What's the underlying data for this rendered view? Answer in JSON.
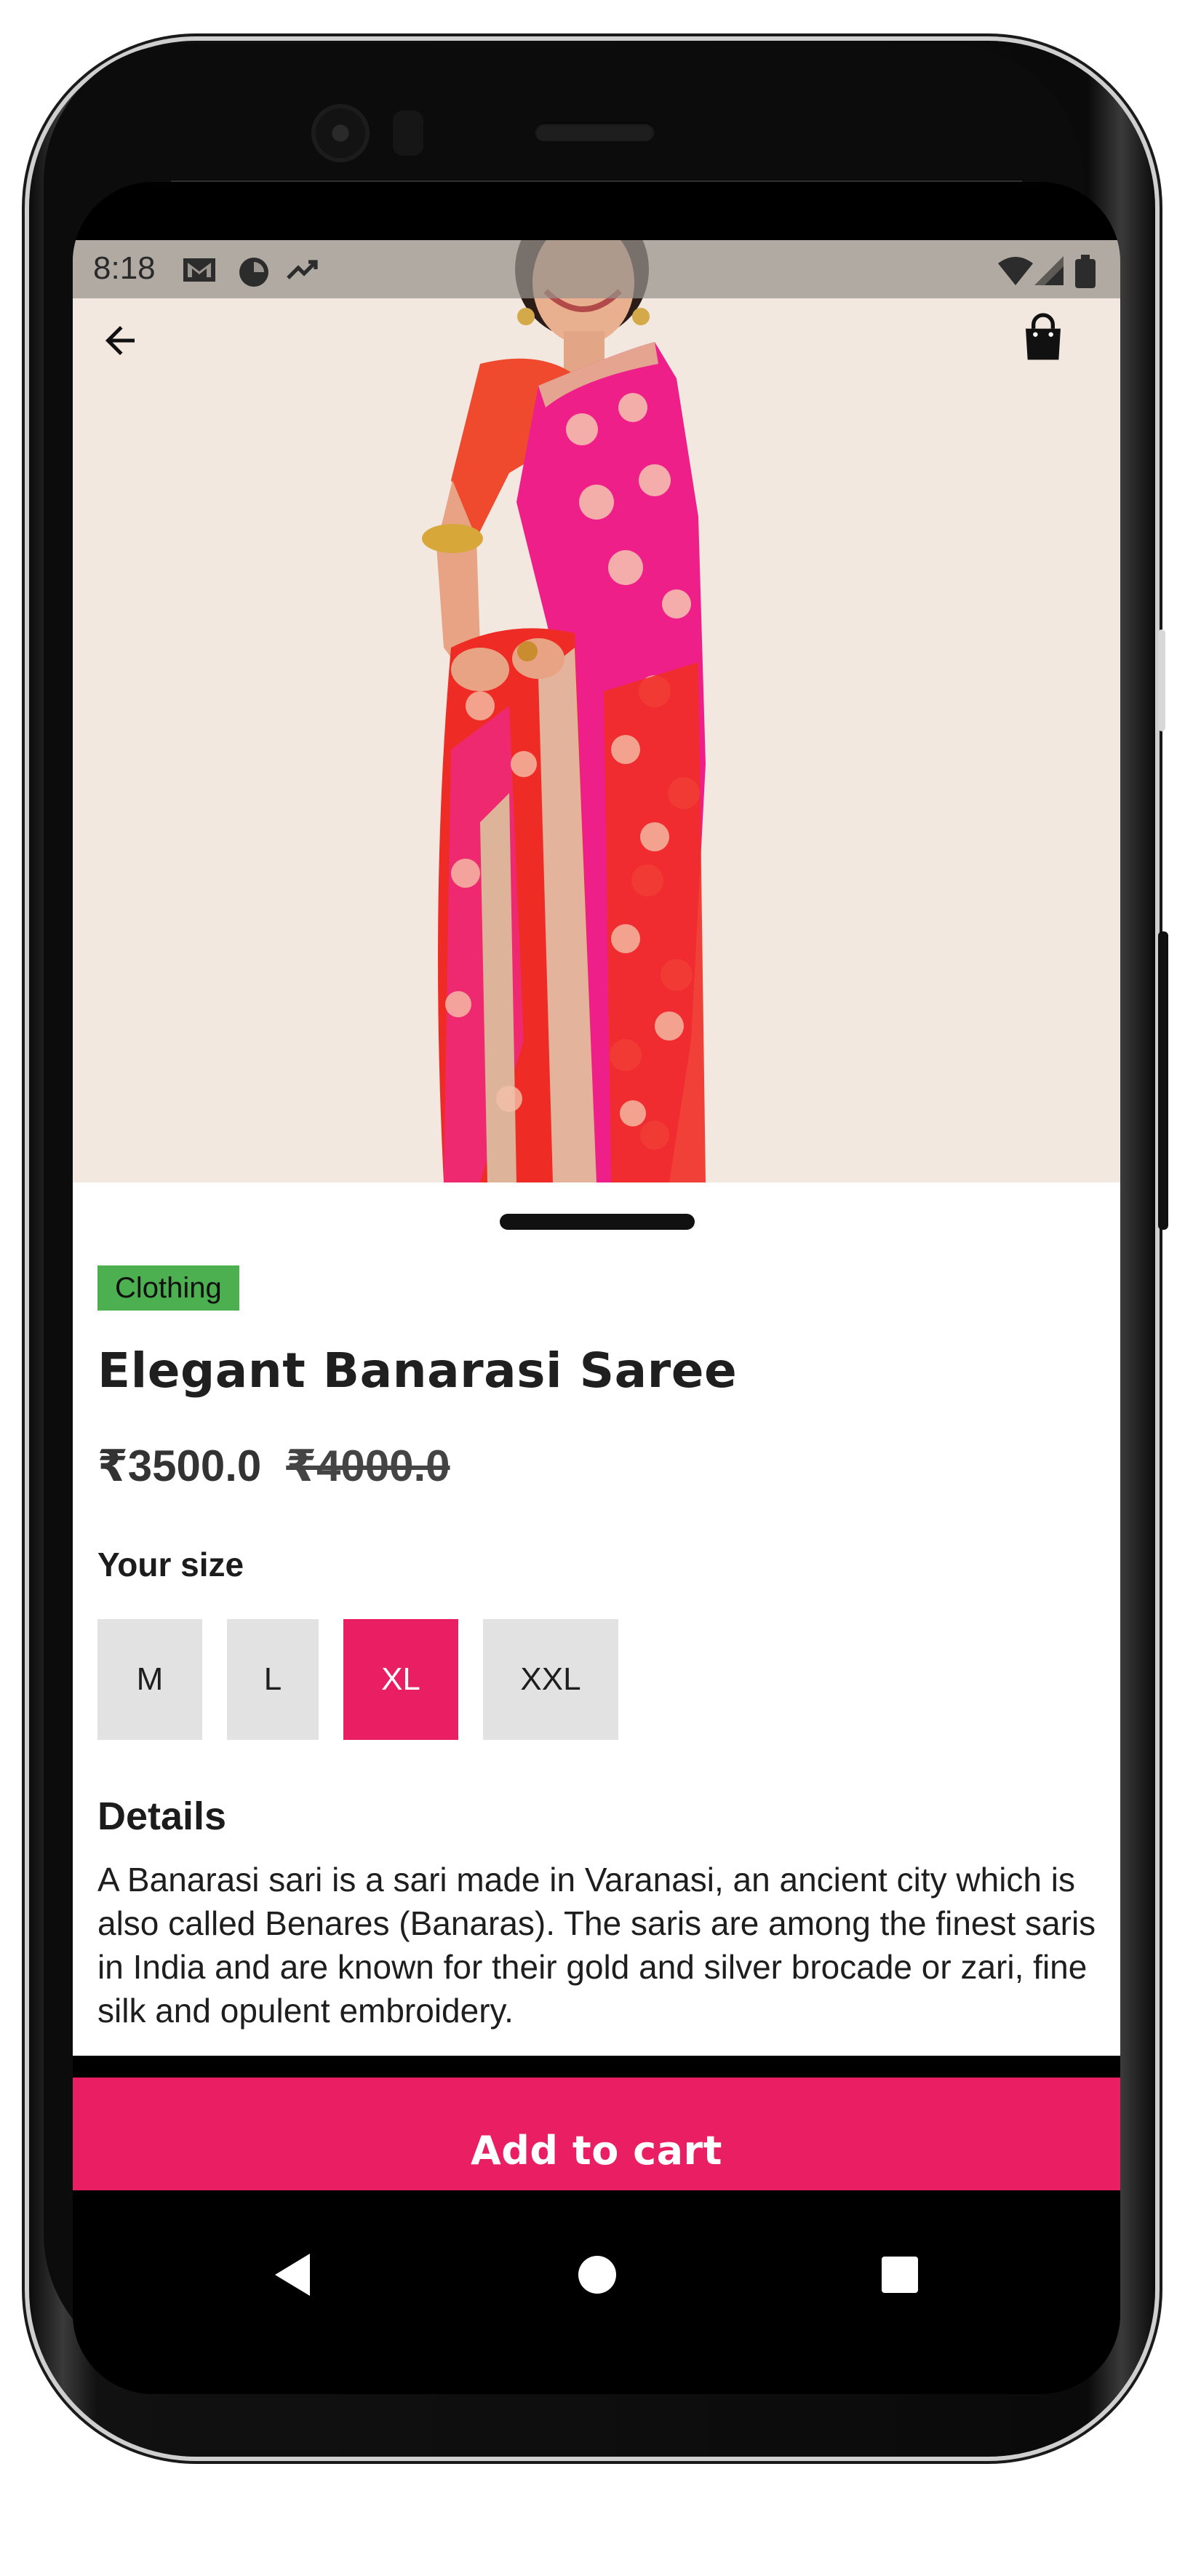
{
  "status_bar": {
    "time": "8:18",
    "icons": [
      "gmail-icon",
      "data-saver-icon",
      "trending-icon",
      "wifi-icon",
      "signal-icon",
      "battery-icon"
    ]
  },
  "header": {
    "back_icon": "arrow-left-icon",
    "cart_icon": "shopping-bag-icon"
  },
  "product": {
    "category": "Clothing",
    "title": "Elegant Banarasi Saree",
    "price": "₹3500.0",
    "original_price": "₹4000.0",
    "size_label": "Your size",
    "sizes": [
      {
        "label": "M",
        "selected": false
      },
      {
        "label": "L",
        "selected": false
      },
      {
        "label": "XL",
        "selected": true
      },
      {
        "label": "XXL",
        "selected": false
      }
    ],
    "details_title": "Details",
    "details_text": "A Banarasi sari is a sari made in Varanasi, an ancient city which is also called Benares (Banaras). The saris are among the finest saris in India and are known for their gold and silver brocade or zari, fine silk and opulent embroidery."
  },
  "cta": {
    "label": "Add to cart"
  },
  "nav": {
    "back": "nav-back-icon",
    "home": "nav-home-icon",
    "recents": "nav-recents-icon"
  },
  "colors": {
    "accent": "#e91e63",
    "chip": "#4cb050",
    "hero_bg": "#f2e8df",
    "size_bg": "#e2e2e2"
  }
}
